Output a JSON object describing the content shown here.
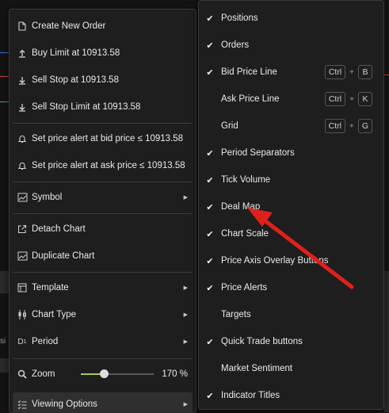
{
  "colors": {
    "accent_arrow": "#e0201a",
    "menu_bg": "#1e1e1e",
    "zoom_fill": "#9bd24a"
  },
  "context_menu": {
    "items": [
      {
        "label": "Create New Order",
        "icon": "new-order-icon"
      },
      {
        "label": "Buy Limit at 10913.58",
        "icon": "buy-limit-icon"
      },
      {
        "label": "Sell Stop at 10913.58",
        "icon": "sell-stop-icon"
      },
      {
        "label": "Sell Stop Limit at 10913.58",
        "icon": "sell-stop-limit-icon"
      },
      {
        "label": "Set price alert at bid price ≤ 10913.58",
        "icon": "bell-icon"
      },
      {
        "label": "Set price alert at ask price ≤ 10913.58",
        "icon": "bell-icon"
      },
      {
        "label": "Symbol",
        "icon": "symbol-icon",
        "has_submenu": true
      },
      {
        "label": "Detach Chart",
        "icon": "detach-icon"
      },
      {
        "label": "Duplicate Chart",
        "icon": "duplicate-icon"
      },
      {
        "label": "Template",
        "icon": "template-icon",
        "has_submenu": true
      },
      {
        "label": "Chart Type",
        "icon": "candlestick-icon",
        "has_submenu": true
      },
      {
        "label": "Period",
        "icon": "period-icon",
        "has_submenu": true
      },
      {
        "label": "Zoom",
        "icon": "zoom-icon"
      },
      {
        "label": "Viewing Options",
        "icon": "viewing-options-icon",
        "has_submenu": true
      }
    ],
    "zoom_value": "170 %",
    "period_icon_text": "D",
    "period_icon_sub": "1"
  },
  "viewing_options": {
    "items": [
      {
        "label": "Positions",
        "checked": true
      },
      {
        "label": "Orders",
        "checked": true
      },
      {
        "label": "Bid Price Line",
        "checked": true,
        "shortcut": [
          "Ctrl",
          "B"
        ]
      },
      {
        "label": "Ask Price Line",
        "checked": false,
        "shortcut": [
          "Ctrl",
          "K"
        ]
      },
      {
        "label": "Grid",
        "checked": false,
        "shortcut": [
          "Ctrl",
          "G"
        ]
      },
      {
        "label": "Period Separators",
        "checked": true
      },
      {
        "label": "Tick Volume",
        "checked": true
      },
      {
        "label": "Deal Map",
        "checked": true
      },
      {
        "label": "Chart Scale",
        "checked": true
      },
      {
        "label": "Price Axis Overlay Buttons",
        "checked": true
      },
      {
        "label": "Price Alerts",
        "checked": true
      },
      {
        "label": "Targets",
        "checked": false
      },
      {
        "label": "Quick Trade buttons",
        "checked": true
      },
      {
        "label": "Market Sentiment",
        "checked": false
      },
      {
        "label": "Indicator Titles",
        "checked": true
      }
    ],
    "check_glyph": "✔",
    "plus_glyph": "+"
  },
  "background": {
    "text_fragment": "si"
  }
}
